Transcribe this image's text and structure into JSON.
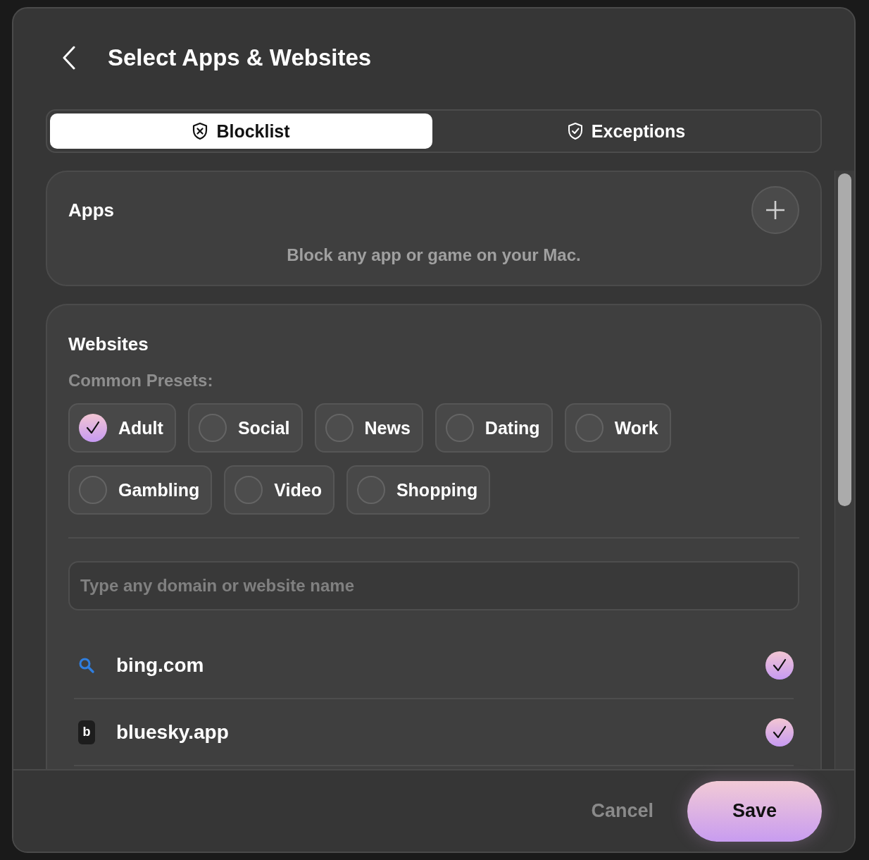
{
  "header": {
    "title": "Select Apps & Websites"
  },
  "tabs": [
    {
      "label": "Blocklist",
      "selected": true,
      "kind": "block"
    },
    {
      "label": "Exceptions",
      "selected": false,
      "kind": "allow"
    }
  ],
  "apps": {
    "title": "Apps",
    "description": "Block any app or game on your Mac."
  },
  "websites": {
    "title": "Websites",
    "presets_label": "Common Presets:",
    "presets": [
      {
        "label": "Adult",
        "checked": true
      },
      {
        "label": "Social",
        "checked": false
      },
      {
        "label": "News",
        "checked": false
      },
      {
        "label": "Dating",
        "checked": false
      },
      {
        "label": "Work",
        "checked": false
      },
      {
        "label": "Gambling",
        "checked": false
      },
      {
        "label": "Video",
        "checked": false
      },
      {
        "label": "Shopping",
        "checked": false
      }
    ],
    "domain_field": {
      "placeholder": "Type any domain or website name"
    },
    "sites": [
      {
        "domain": "bing.com",
        "kind": "search",
        "checked": true
      },
      {
        "domain": "bluesky.app",
        "kind": "letter",
        "icon_text": "b",
        "checked": true
      }
    ]
  },
  "footer": {
    "cancel": "Cancel",
    "save": "Save"
  }
}
